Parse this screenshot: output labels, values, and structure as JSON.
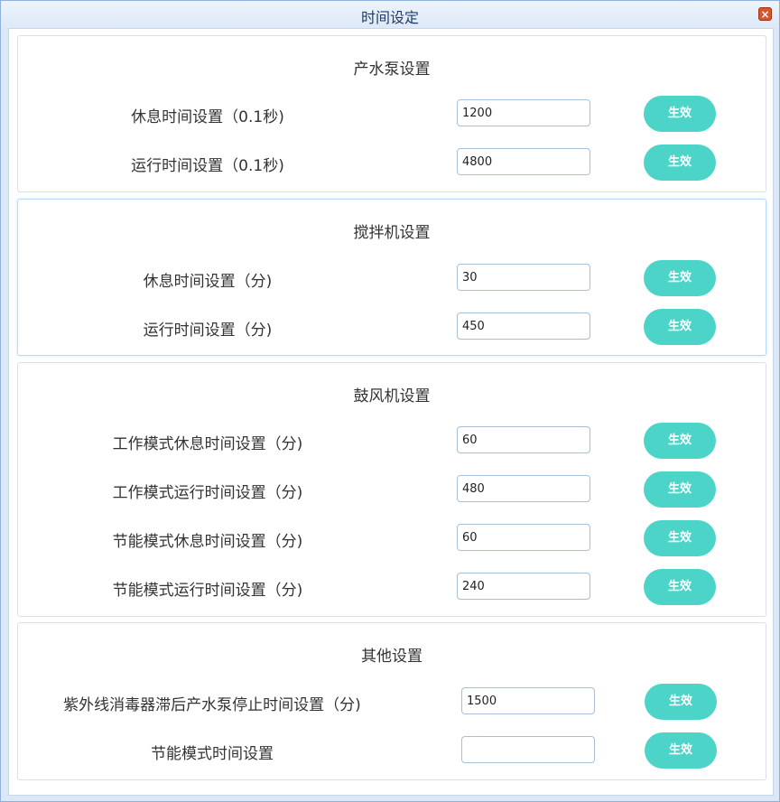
{
  "window": {
    "title": "时间设定"
  },
  "sections": [
    {
      "title": "产水泵设置",
      "rows": [
        {
          "label": "休息时间设置（0.1秒)",
          "value": "1200",
          "button": "生效"
        },
        {
          "label": "运行时间设置（0.1秒)",
          "value": "4800",
          "button": "生效"
        }
      ]
    },
    {
      "title": "搅拌机设置",
      "rows": [
        {
          "label": "休息时间设置（分)",
          "value": "30",
          "button": "生效"
        },
        {
          "label": "运行时间设置（分)",
          "value": "450",
          "button": "生效"
        }
      ]
    },
    {
      "title": "鼓风机设置",
      "rows": [
        {
          "label": "工作模式休息时间设置（分)",
          "value": "60",
          "button": "生效"
        },
        {
          "label": "工作模式运行时间设置（分)",
          "value": "480",
          "button": "生效"
        },
        {
          "label": "节能模式休息时间设置（分)",
          "value": "60",
          "button": "生效"
        },
        {
          "label": "节能模式运行时间设置（分)",
          "value": "240",
          "button": "生效"
        }
      ]
    },
    {
      "title": "其他设置",
      "rows": [
        {
          "label": "紫外线消毒器滞后产水泵停止时间设置（分)",
          "value": "1500",
          "button": "生效"
        },
        {
          "label": "节能模式时间设置",
          "value": "",
          "button": "生效"
        }
      ]
    }
  ],
  "colors": {
    "button": "#4dd4c9",
    "title_text": "#1e3c6a",
    "close": "#d9532c"
  },
  "icons": {
    "close": "close-icon"
  }
}
